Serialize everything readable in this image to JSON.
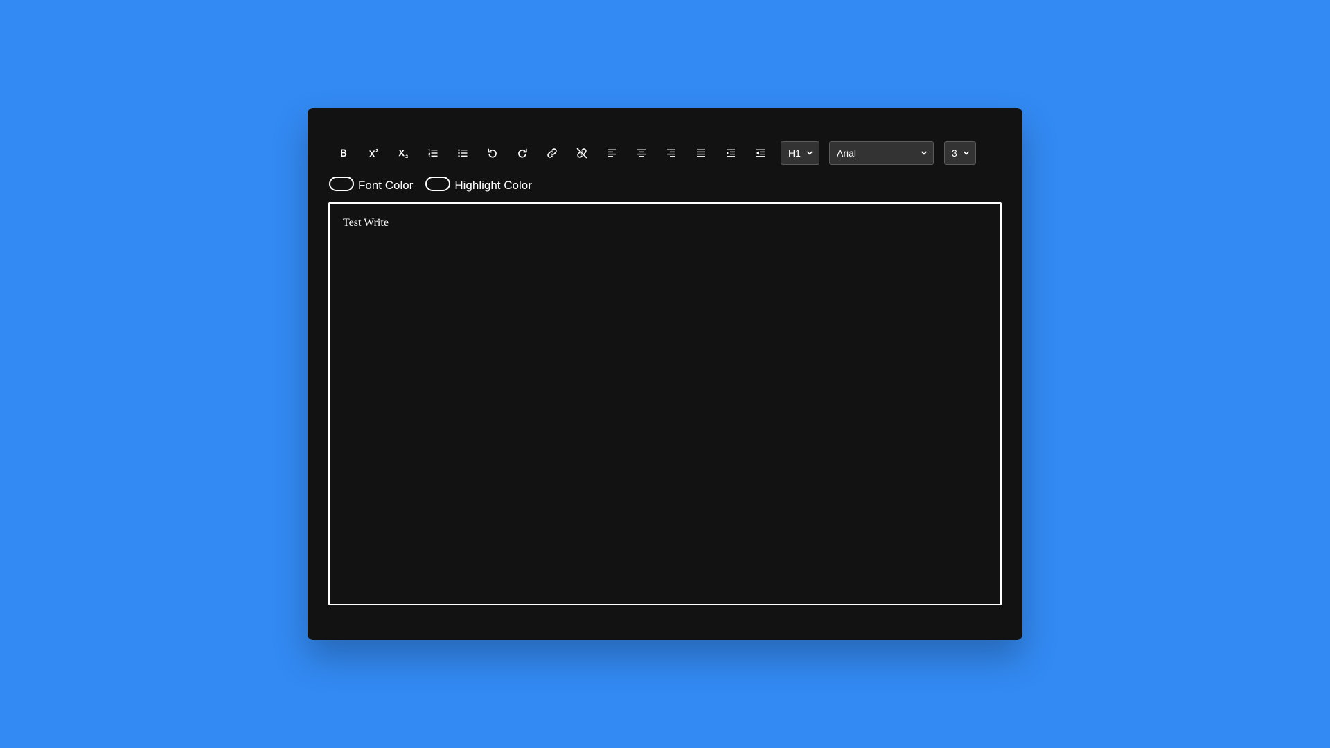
{
  "theme": {
    "background": "#338af3",
    "card": "#121212",
    "text": "#ffffff",
    "select_bg": "#333333"
  },
  "toolbar": {
    "buttons": [
      {
        "id": "bold",
        "icon": "bold-icon"
      },
      {
        "id": "superscript",
        "icon": "superscript-icon"
      },
      {
        "id": "subscript",
        "icon": "subscript-icon"
      },
      {
        "id": "ordered-list",
        "icon": "ordered-list-icon"
      },
      {
        "id": "unordered-list",
        "icon": "unordered-list-icon"
      },
      {
        "id": "undo",
        "icon": "undo-icon"
      },
      {
        "id": "redo",
        "icon": "redo-icon"
      },
      {
        "id": "link",
        "icon": "link-icon"
      },
      {
        "id": "unlink",
        "icon": "unlink-icon"
      },
      {
        "id": "align-left",
        "icon": "align-left-icon"
      },
      {
        "id": "align-center",
        "icon": "align-center-icon"
      },
      {
        "id": "align-right",
        "icon": "align-right-icon"
      },
      {
        "id": "align-justify",
        "icon": "align-justify-icon"
      },
      {
        "id": "indent",
        "icon": "indent-icon"
      },
      {
        "id": "outdent",
        "icon": "outdent-icon"
      }
    ],
    "heading_select": {
      "value": "H1"
    },
    "font_select": {
      "value": "Arial"
    },
    "size_select": {
      "value": "3"
    }
  },
  "colors": {
    "font_color_label": "Font Color",
    "highlight_color_label": "Highlight Color"
  },
  "editor": {
    "content": "Test Write"
  }
}
